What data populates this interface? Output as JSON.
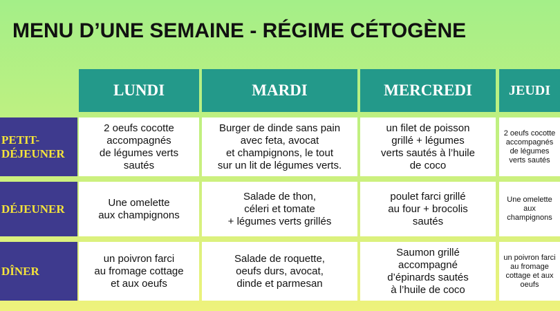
{
  "title": "MENU D’UNE SEMAINE - RÉGIME CÉTOGÈNE",
  "days": [
    "LUNDI",
    "MARDI",
    "MERCREDI",
    "JEUDI"
  ],
  "meals": [
    "PETIT-\nDÉJEUNER",
    "DÉJEUNER",
    "DÎNER"
  ],
  "cells": [
    [
      "2 oeufs cocotte\naccompagnés\nde légumes verts\nsautés",
      "Burger de dinde sans pain\navec feta, avocat\net champignons, le tout\nsur un lit de légumes verts.",
      "un filet de poisson\ngrillé + légumes\nverts sautés à l’huile\nde coco",
      "2 oeufs cocotte\naccompagnés\nde légumes verts\nsautés"
    ],
    [
      "Une omelette\naux champignons",
      "Salade de thon,\ncéleri et tomate\n+ légumes verts grillés",
      "poulet farci grillé\nau four + brocolis\nsautés",
      "Une omelette\naux champignons"
    ],
    [
      "un poivron farci\nau fromage cottage\net aux oeufs",
      "Salade de roquette,\noeufs durs, avocat,\ndinde et parmesan",
      "Saumon grillé\naccompagné\nd’épinards sautés\nà l’huile de coco",
      "un poivron farci\nau fromage cottage\net aux oeufs"
    ]
  ],
  "colors": {
    "header": "#23998a",
    "label_bg": "#3e3a8e",
    "label_text": "#f5e43a"
  }
}
